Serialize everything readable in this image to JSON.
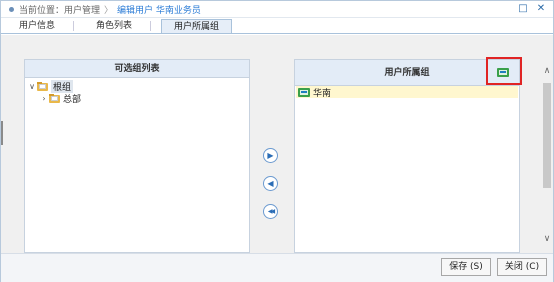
{
  "titlebar": {
    "current_position_label": "当前位置：",
    "breadcrumb": [
      "用户管理",
      "编辑用户 华南业务员"
    ],
    "separator": "〉",
    "restore_icon": "□",
    "close_icon": "✕"
  },
  "tabs": [
    {
      "label": "用户信息",
      "active": false
    },
    {
      "label": "角色列表",
      "active": false
    },
    {
      "label": "用户所属组",
      "active": true
    }
  ],
  "left_panel": {
    "title": "可选组列表",
    "tree": [
      {
        "label": "根组",
        "expanded": true,
        "selected": true,
        "toggle": "∨"
      },
      {
        "label": "总部",
        "expanded": false,
        "selected": false,
        "toggle": "›"
      }
    ]
  },
  "right_panel": {
    "title": "用户所属组",
    "items": [
      {
        "label": "华南"
      }
    ]
  },
  "move_buttons": {
    "add": "▶",
    "remove": "◀",
    "remove_all": "◀◀"
  },
  "scrollbar": {
    "up": "∧",
    "down": "∨"
  },
  "footer": {
    "save_label": "保存 (S)",
    "close_label": "关闭 (C)"
  },
  "colors": {
    "accent": "#2a7bd6",
    "highlight": "#e02424",
    "panel_header": "#e3ecf7",
    "item_highlight": "#fff7cf"
  }
}
